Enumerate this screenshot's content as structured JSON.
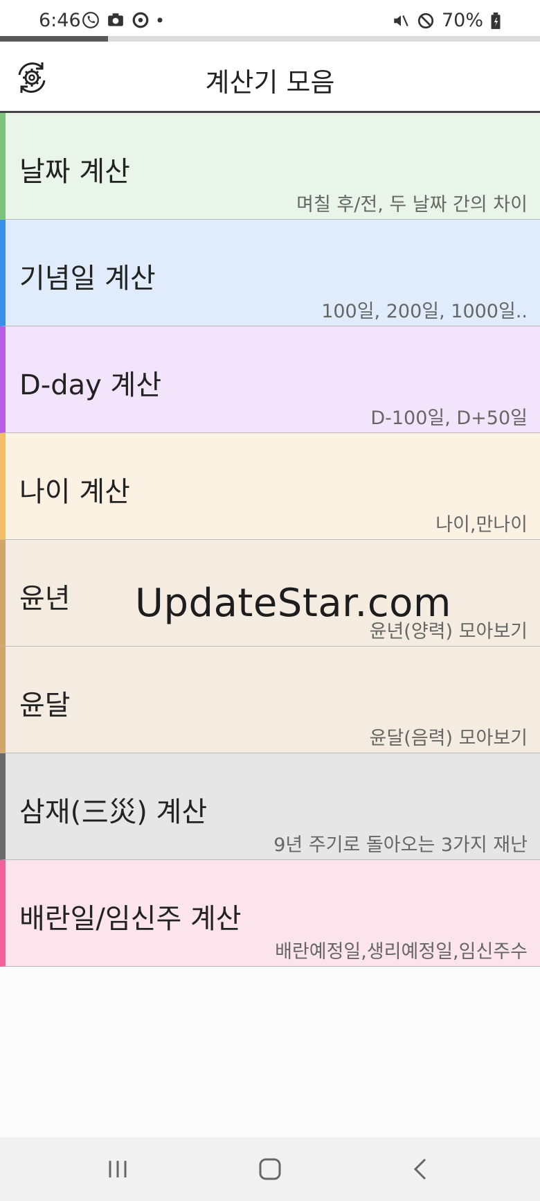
{
  "status_bar": {
    "time": "6:46",
    "battery": "70%",
    "icons": [
      "phone-icon",
      "camera-icon",
      "sync-icon",
      "dot-icon",
      "mute-icon",
      "block-icon",
      "battery-icon"
    ]
  },
  "header": {
    "title": "계산기 모음",
    "settings_icon": "settings-sync-icon"
  },
  "progress": {
    "value": 0.2
  },
  "items": [
    {
      "title": "날짜 계산",
      "subtitle": "며칠 후/전, 두 날짜 간의 차이",
      "bg": "#e8f5e8",
      "accent": "#7cc47c"
    },
    {
      "title": "기념일 계산",
      "subtitle": "100일, 200일, 1000일..",
      "bg": "#e0ecfb",
      "accent": "#3a8fe8"
    },
    {
      "title": "D-day 계산",
      "subtitle": "D-100일, D+50일",
      "bg": "#f1e4fb",
      "accent": "#b65de8"
    },
    {
      "title": "나이 계산",
      "subtitle": "나이,만나이",
      "bg": "#fcf2e4",
      "accent": "#f2bf66"
    },
    {
      "title": "윤년",
      "subtitle": "윤년(양력) 모아보기",
      "bg": "#f4ece0",
      "accent": "#d1a66a"
    },
    {
      "title": "윤달",
      "subtitle": "윤달(음력) 모아보기",
      "bg": "#f4ece0",
      "accent": "#d1a66a"
    },
    {
      "title": "삼재(三災) 계산",
      "subtitle": "9년 주기로 돌아오는 3가지 재난",
      "bg": "#e6e6e6",
      "accent": "#6a6a6a"
    },
    {
      "title": "배란일/임신주 계산",
      "subtitle": "배란예정일,생리예정일,임신주수",
      "bg": "#fce4ec",
      "accent": "#f0609a"
    }
  ],
  "watermark": "UpdateStar.com",
  "nav": {
    "icons": [
      "recent-apps-icon",
      "home-icon",
      "back-icon"
    ]
  }
}
